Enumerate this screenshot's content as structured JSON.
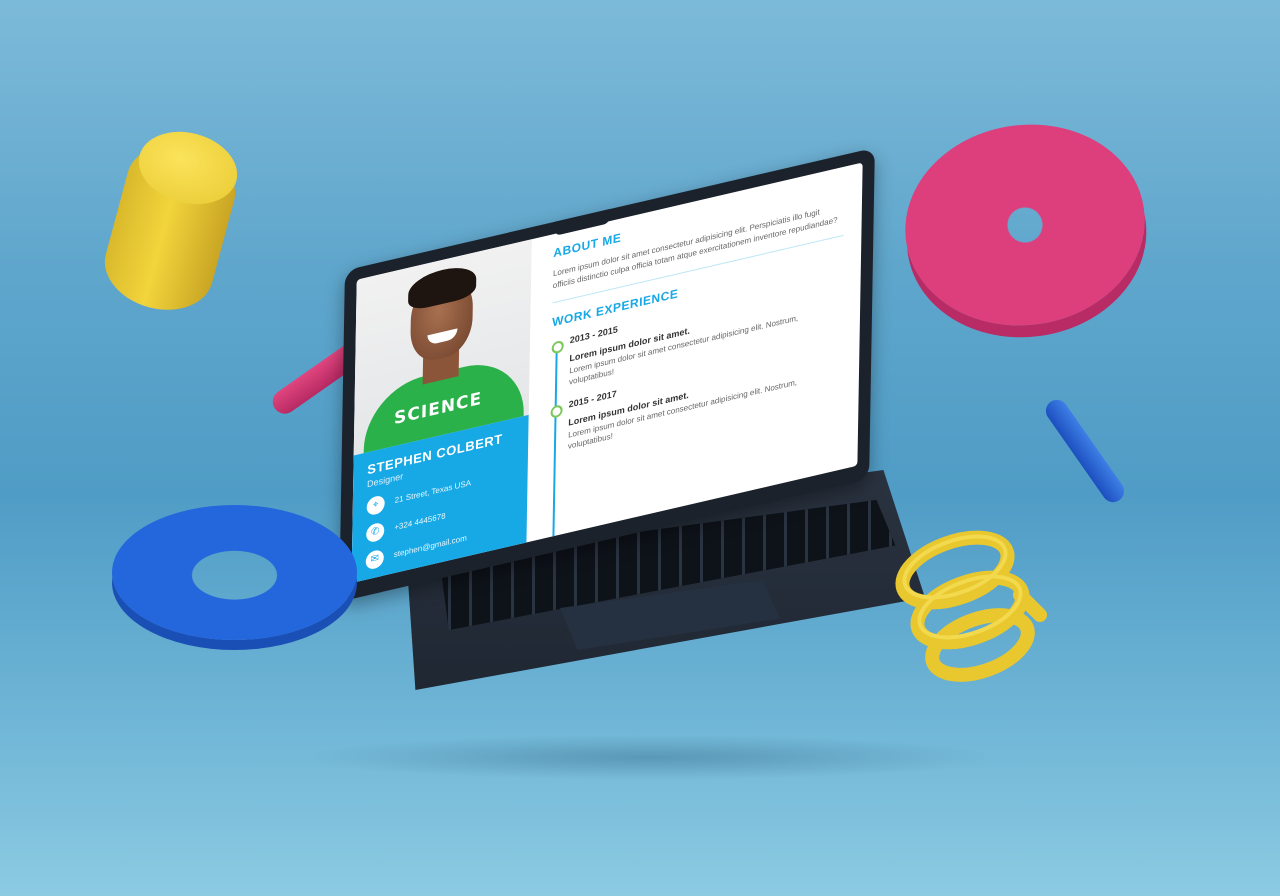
{
  "resume": {
    "photo_shirt_text": "SCIENCE",
    "name": "STEPHEN COLBERT",
    "role": "Designer",
    "contacts": [
      {
        "icon": "location-icon",
        "text": "21 Street, Texas USA"
      },
      {
        "icon": "phone-icon",
        "text": "+324 4445678"
      },
      {
        "icon": "mail-icon",
        "text": "stephen@gmail.com"
      }
    ],
    "about": {
      "title": "ABOUT ME",
      "text": "Lorem ipsum dolor sit amet consectetur adipisicing elit. Perspiciatis illo fugit officiis distinctio culpa officia totam atque exercitationem inventore repudiandae?"
    },
    "work": {
      "title": "WORK EXPERIENCE",
      "jobs": [
        {
          "years": "2013 - 2015",
          "title": "Lorem ipsum dolor sit amet.",
          "desc": "Lorem ipsum dolor sit amet consectetur adipisicing elit. Nostrum, voluptatibus!"
        },
        {
          "years": "2015 - 2017",
          "title": "Lorem ipsum dolor sit amet.",
          "desc": "Lorem ipsum dolor sit amet consectetur adipisicing elit. Nostrum, voluptatibus!"
        }
      ]
    }
  },
  "colors": {
    "accent": "#17a8e6",
    "background": "#5fa6cc",
    "pink": "#dd3f7d",
    "blue": "#2466dc",
    "yellow": "#f2d43c"
  }
}
